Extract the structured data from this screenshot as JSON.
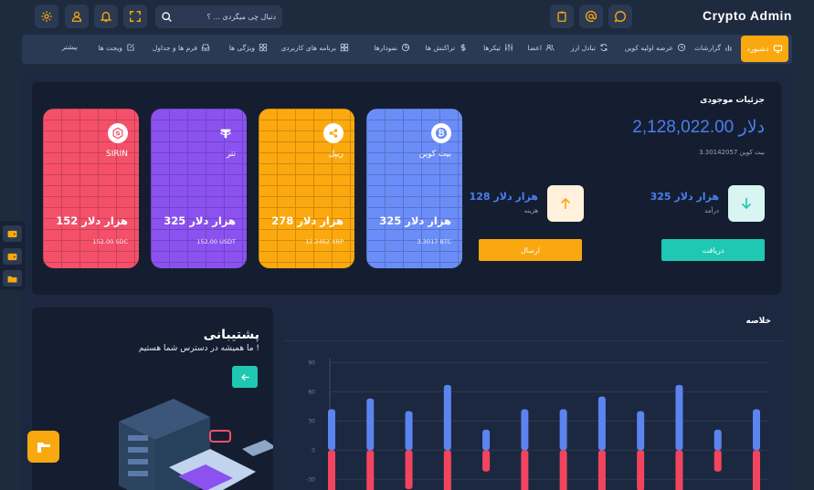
{
  "header": {
    "brand": "Crypto Admin",
    "search_placeholder": "دنبال چی میگردی ... ؟"
  },
  "nav": {
    "active": "دشبورد",
    "items": [
      "گزارشات",
      "عرضه اولیه کوین",
      "تبادل ارز",
      "اعضا",
      "تیکرها",
      "تراکنش ها",
      "نمودارها",
      "برنامه های کاربردی",
      "ویژگی ها",
      "فرم ها و جداول",
      "ویجت ها",
      "بیشتر"
    ]
  },
  "wallet": {
    "title": "جزئیات موجودی",
    "balance": "2,128,022.00 دلار",
    "balance_sub": "3.30142057 بیت کوین",
    "income": {
      "value": "325 هزار دلار",
      "label": "درآمد",
      "button": "دریافت"
    },
    "expense": {
      "value": "128 هزار دلار",
      "label": "هزینه",
      "button": "ارسال"
    },
    "cards": [
      {
        "name": "بیت کوین",
        "amount": "325 هزار دلار",
        "sub": "3.3017 BTC",
        "color": "#6b8df7",
        "icon": "bitcoin-icon"
      },
      {
        "name": "ریپل",
        "amount": "278 هزار دلار",
        "sub": "12.2462 XRP",
        "color": "#fca90f",
        "icon": "ripple-icon"
      },
      {
        "name": "تتر",
        "amount": "325 هزار دلار",
        "sub": "152.00 USDT",
        "color": "#8b52f0",
        "icon": "tether-icon"
      },
      {
        "name": "SIRIN",
        "amount": "152 هزار دلار",
        "sub": "152.00 SDC",
        "color": "#f4506a",
        "icon": "sirin-icon"
      }
    ]
  },
  "support": {
    "title": "پشتیبانی",
    "subtitle": "ما همیشه در دسترس شما هستیم !"
  },
  "summary": {
    "title": "خلاصه"
  },
  "chart_data": {
    "type": "bar",
    "title": "خلاصه",
    "yticks": [
      90,
      60,
      30,
      0,
      -30
    ],
    "ylim": [
      -55,
      95
    ],
    "colors": {
      "positive": "#5c84ef",
      "negative": "#f3445f"
    },
    "series": [
      {
        "values": [
          42,
          53,
          40,
          67,
          21,
          42,
          42,
          55,
          40,
          67,
          21,
          42
        ]
      },
      {
        "values": [
          -45,
          -55,
          -40,
          -55,
          -22,
          -45,
          -48,
          -55,
          -42,
          -55,
          -22,
          -45
        ]
      }
    ],
    "categories": [
      "",
      "",
      "",
      "",
      "",
      "",
      "",
      "",
      "",
      "",
      "",
      ""
    ]
  }
}
